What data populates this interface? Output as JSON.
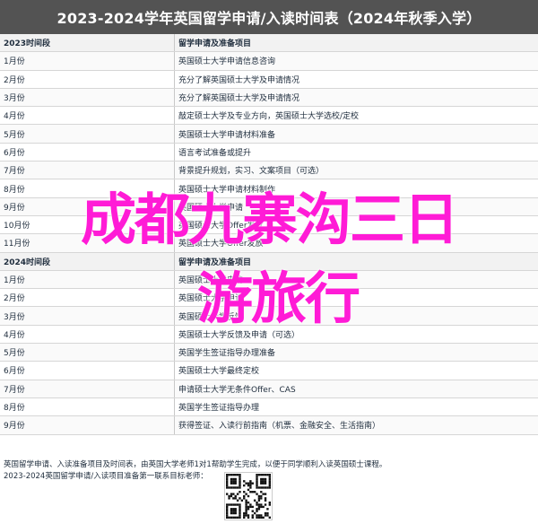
{
  "title": "2023-2024学年英国留学申请/入读时间表（2024年秋季入学）",
  "section1": {
    "header": [
      "2023时间段",
      "留学申请及准备项目"
    ],
    "rows": [
      [
        "1月份",
        "英国硕士大学申请信息咨询"
      ],
      [
        "2月份",
        "充分了解英国硕士大学及申请情况"
      ],
      [
        "3月份",
        "充分了解英国硕士大学及申请情况"
      ],
      [
        "4月份",
        "敲定硕士大学及专业方向，英国硕士大学选校/定校"
      ],
      [
        "5月份",
        "英国硕士大学申请材料准备"
      ],
      [
        "6月份",
        "语言考试准备或提升"
      ],
      [
        "7月份",
        "背景提升规划，实习、文案项目（可选）"
      ],
      [
        "8月份",
        "英国硕士大学申请材料制作"
      ],
      [
        "9月份",
        "英国硕士大学申请"
      ],
      [
        "10月份",
        "英国硕士大学Offer发放"
      ],
      [
        "11月份",
        "英国硕士大学Offer发放"
      ]
    ]
  },
  "section2": {
    "header": [
      "2024时间段",
      "留学申请及准备项目"
    ],
    "rows": [
      [
        "1月份",
        "英国硕士大学申请"
      ],
      [
        "2月份",
        "英国硕士大学申请"
      ],
      [
        "3月份",
        "英国硕士大学反馈"
      ],
      [
        "4月份",
        "英国硕士大学反馈及申请（可选）"
      ],
      [
        "5月份",
        "英国学生签证指导办理准备"
      ],
      [
        "6月份",
        "英国硕士大学最终定校"
      ],
      [
        "7月份",
        "申请硕士大学无条件Offer、CAS"
      ],
      [
        "8月份",
        "英国学生签证指导办理"
      ],
      [
        "9月份",
        "获得签证、入读行前指南（机票、金融安全、生活指南）"
      ]
    ]
  },
  "footer": {
    "line1": "英国留学申请、入读准备项目及时间表，由英国大学老师1对1帮助学生完成，以便于同学顺利入读英国硕士课程。",
    "line2": "2023-2024英国留学申请/入读项目准备第一联系目标老师："
  },
  "overlay": {
    "line1": "成都九寨沟三日",
    "line2": "游旅行"
  },
  "colors": {
    "title_bg": "#535353",
    "overlay_text": "#ff1bd6"
  },
  "icons": [
    "qr-code-icon"
  ]
}
